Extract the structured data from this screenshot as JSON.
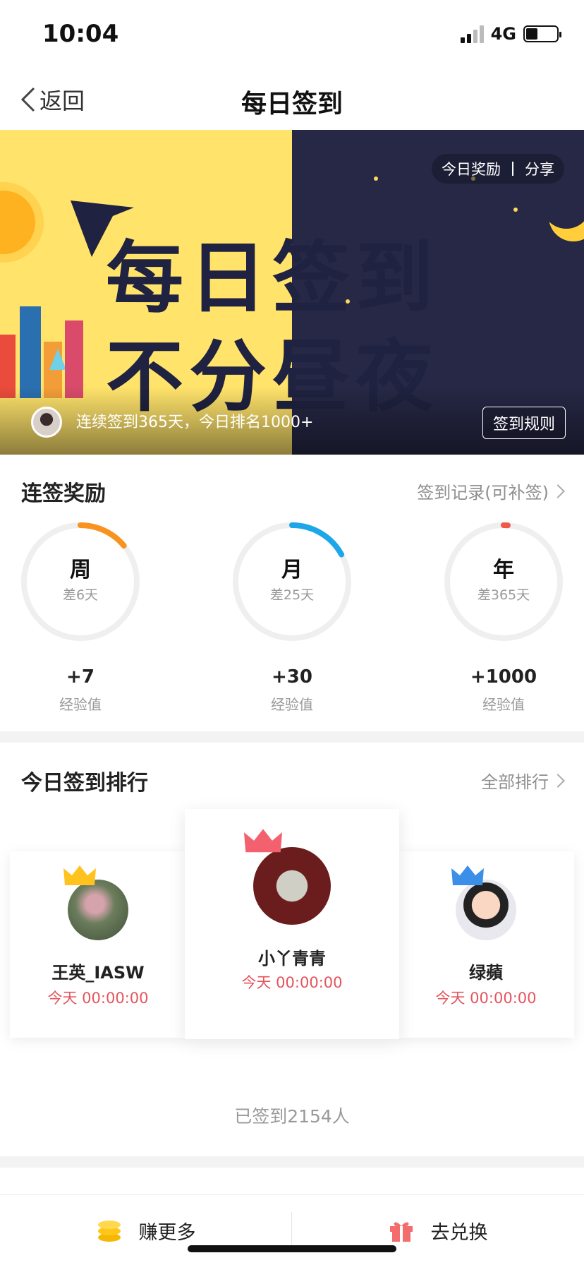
{
  "status_bar": {
    "time": "10:04",
    "network": "4G"
  },
  "nav": {
    "back_label": "返回",
    "title": "每日签到"
  },
  "banner": {
    "headline_line1": "每日签到",
    "headline_line2": "不分昼夜",
    "top_actions": [
      "今日奖励",
      "分享"
    ],
    "streak_text": "连续签到365天，今日排名1000+",
    "rules_button": "签到规则"
  },
  "streak_rewards": {
    "title": "连签奖励",
    "link": "签到记录(可补签)",
    "items": [
      {
        "label": "周",
        "remaining": "差6天",
        "reward": "+7",
        "unit": "经验值",
        "color": "#f7931e",
        "progress": 0.14
      },
      {
        "label": "月",
        "remaining": "差25天",
        "reward": "+30",
        "unit": "经验值",
        "color": "#1ea7e8",
        "progress": 0.17
      },
      {
        "label": "年",
        "remaining": "差365天",
        "reward": "+1000",
        "unit": "经验值",
        "color": "#f05a4a",
        "progress": 0.0
      }
    ]
  },
  "ranking": {
    "title": "今日签到排行",
    "link": "全部排行",
    "entries": [
      {
        "name": "王英_IASW",
        "time": "今天 00:00:00",
        "crown_color": "#ffc21f"
      },
      {
        "name": "小丫青青",
        "time": "今天 00:00:00",
        "crown_color": "#f2616d"
      },
      {
        "name": "绿蘋",
        "time": "今天 00:00:00",
        "crown_color": "#3b8fe8"
      }
    ],
    "signed_count": "已签到2154人"
  },
  "tab_bar": {
    "earn_label": "赚更多",
    "redeem_label": "去兑换"
  }
}
